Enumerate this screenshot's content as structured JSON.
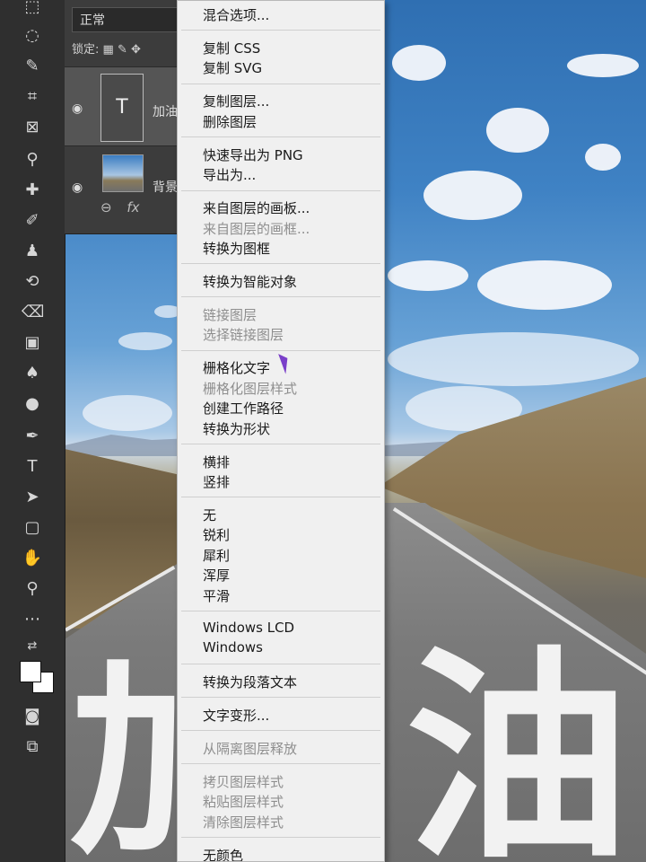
{
  "layers_panel": {
    "blend_mode": "正常",
    "lock_label": "锁定:",
    "layers": [
      {
        "name": "加油",
        "thumb": "T"
      },
      {
        "name": "背景"
      }
    ],
    "footer": "fx"
  },
  "canvas": {
    "big_text": [
      "加",
      "油"
    ]
  },
  "context_menu": {
    "groups": [
      [
        {
          "label": "混合选项...",
          "disabled": false
        }
      ],
      [
        {
          "label": "复制 CSS",
          "disabled": false
        },
        {
          "label": "复制 SVG",
          "disabled": false
        }
      ],
      [
        {
          "label": "复制图层...",
          "disabled": false
        },
        {
          "label": "删除图层",
          "disabled": false
        }
      ],
      [
        {
          "label": "快速导出为 PNG",
          "disabled": false
        },
        {
          "label": "导出为...",
          "disabled": false
        }
      ],
      [
        {
          "label": "来自图层的画板...",
          "disabled": false
        },
        {
          "label": "来自图层的画框...",
          "disabled": true
        },
        {
          "label": "转换为图框",
          "disabled": false
        }
      ],
      [
        {
          "label": "转换为智能对象",
          "disabled": false
        }
      ],
      [
        {
          "label": "链接图层",
          "disabled": true
        },
        {
          "label": "选择链接图层",
          "disabled": true
        }
      ],
      [
        {
          "label": "栅格化文字",
          "disabled": false
        },
        {
          "label": "栅格化图层样式",
          "disabled": true
        },
        {
          "label": "创建工作路径",
          "disabled": false
        },
        {
          "label": "转换为形状",
          "disabled": false
        }
      ],
      [
        {
          "label": "横排",
          "disabled": false
        },
        {
          "label": "竖排",
          "disabled": false
        }
      ],
      [
        {
          "label": "无",
          "disabled": false
        },
        {
          "label": "锐利",
          "disabled": false
        },
        {
          "label": "犀利",
          "disabled": false
        },
        {
          "label": "浑厚",
          "disabled": false
        },
        {
          "label": "平滑",
          "disabled": false
        }
      ],
      [
        {
          "label": "Windows LCD",
          "disabled": false
        },
        {
          "label": "Windows",
          "disabled": false
        }
      ],
      [
        {
          "label": "转换为段落文本",
          "disabled": false
        }
      ],
      [
        {
          "label": "文字变形...",
          "disabled": false
        }
      ],
      [
        {
          "label": "从隔离图层释放",
          "disabled": true
        }
      ],
      [
        {
          "label": "拷贝图层样式",
          "disabled": true
        },
        {
          "label": "粘贴图层样式",
          "disabled": true
        },
        {
          "label": "清除图层样式",
          "disabled": true
        }
      ],
      [
        {
          "label": "无颜色",
          "disabled": false
        }
      ]
    ]
  },
  "colors": {
    "menu_bg": "#f0f0f0",
    "menu_text": "#1a1a1a",
    "menu_disabled": "#8e8e8e",
    "toolbar_bg": "#2f2f2f",
    "panel_bg": "#3c3c3c",
    "cursor": "#7a3fc9"
  },
  "toolbar_icons": [
    "marquee-icon",
    "lasso-icon",
    "quick-select-icon",
    "crop-icon",
    "frame-icon",
    "eyedropper-icon",
    "healing-icon",
    "brush-icon",
    "stamp-icon",
    "history-brush-icon",
    "eraser-icon",
    "gradient-icon",
    "blur-icon",
    "dodge-icon",
    "pen-icon",
    "type-icon",
    "path-select-icon",
    "rectangle-icon",
    "hand-icon",
    "zoom-icon",
    "more-icon"
  ]
}
